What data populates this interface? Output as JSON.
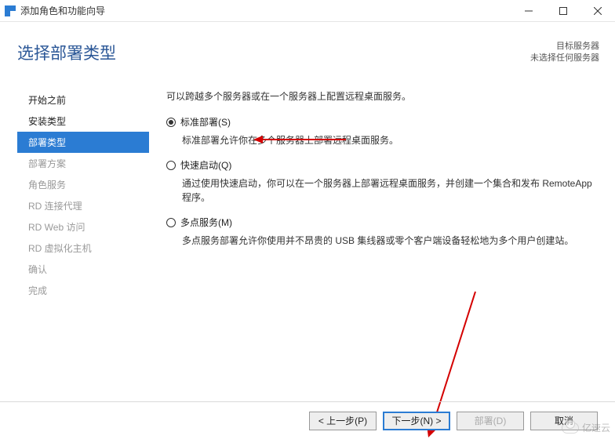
{
  "titlebar": {
    "title": "添加角色和功能向导"
  },
  "heading": "选择部署类型",
  "server_info": {
    "line1": "目标服务器",
    "line2": "未选择任何服务器"
  },
  "sidebar": {
    "items": [
      {
        "label": "开始之前",
        "state": "enabled"
      },
      {
        "label": "安装类型",
        "state": "enabled"
      },
      {
        "label": "部署类型",
        "state": "active"
      },
      {
        "label": "部署方案",
        "state": "dim"
      },
      {
        "label": "角色服务",
        "state": "dim"
      },
      {
        "label": "RD 连接代理",
        "state": "dim"
      },
      {
        "label": "RD Web 访问",
        "state": "dim"
      },
      {
        "label": "RD 虚拟化主机",
        "state": "dim"
      },
      {
        "label": "确认",
        "state": "dim"
      },
      {
        "label": "完成",
        "state": "dim"
      }
    ]
  },
  "main": {
    "intro": "可以跨越多个服务器或在一个服务器上配置远程桌面服务。",
    "options": [
      {
        "label": "标准部署(S)",
        "checked": true,
        "desc": "标准部署允许你在多个服务器上部署远程桌面服务。"
      },
      {
        "label": "快速启动(Q)",
        "checked": false,
        "desc": "通过使用快速启动，你可以在一个服务器上部署远程桌面服务，并创建一个集合和发布 RemoteApp 程序。"
      },
      {
        "label": "多点服务(M)",
        "checked": false,
        "desc": "多点服务部署允许你使用并不昂贵的 USB 集线器或零个客户端设备轻松地为多个用户创建站。"
      }
    ]
  },
  "footer": {
    "prev": "< 上一步(P)",
    "next": "下一步(N) >",
    "deploy": "部署(D)",
    "cancel": "取消"
  },
  "watermark": "亿速云",
  "annotation_color": "#d40000"
}
